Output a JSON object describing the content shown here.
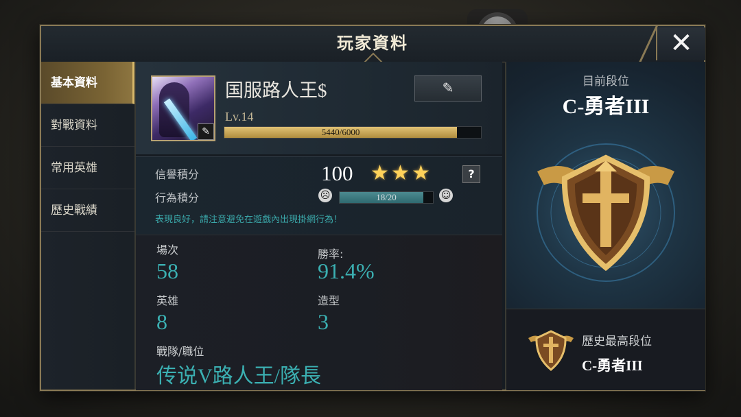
{
  "window": {
    "title": "玩家資料",
    "close_label": "✕"
  },
  "sidebar": {
    "items": [
      {
        "label": "基本資料",
        "active": true
      },
      {
        "label": "對戰資料",
        "active": false
      },
      {
        "label": "常用英雄",
        "active": false
      },
      {
        "label": "歷史戰績",
        "active": false
      }
    ]
  },
  "profile": {
    "name": "国服路人王$",
    "level": "Lv.14",
    "xp_text": "5440/6000",
    "xp_current": 5440,
    "xp_max": 6000,
    "rename_icon": "pencil-icon",
    "avatar_edit_icon": "edit-icon"
  },
  "credit": {
    "credit_label": "信譽積分",
    "credit_value": "100",
    "stars": 3,
    "help_label": "?",
    "behavior_label": "行為積分",
    "behavior_text": "18/20",
    "behavior_current": 18,
    "behavior_max": 20,
    "note": "表現良好，請注意避免在遊戲內出現掛網行為！"
  },
  "stats": {
    "matches_label": "場次",
    "matches_value": "58",
    "winrate_label": "勝率:",
    "winrate_value": "91.4%",
    "heroes_label": "英雄",
    "heroes_value": "8",
    "skins_label": "造型",
    "skins_value": "3",
    "team_label": "戰隊/職位",
    "team_value": "传说V路人王/隊長"
  },
  "rank": {
    "current_label": "目前段位",
    "current_value": "C-勇者III",
    "best_label": "歷史最高段位",
    "best_value": "C-勇者III"
  },
  "colors": {
    "gold": "#c9a55a",
    "teal": "#3bb0b2",
    "star": "#ffd25a"
  }
}
